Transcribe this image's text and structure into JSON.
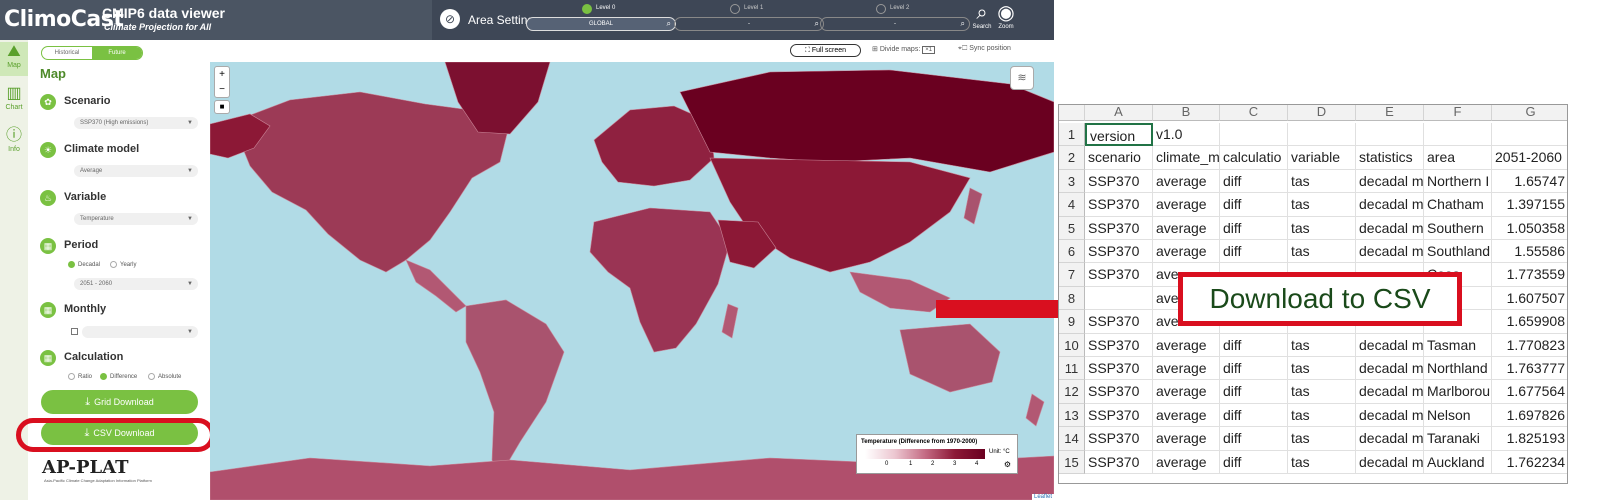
{
  "header": {
    "brand": "ClimoCast",
    "product": "CMIP6 data viewer",
    "tagline": "Climate Projection for All",
    "area_settings": "Area Settings",
    "levels": [
      {
        "label": "Level 0",
        "value": "GLOBAL",
        "active": true
      },
      {
        "label": "Level 1",
        "value": "-",
        "active": false
      },
      {
        "label": "Level 2",
        "value": "-",
        "active": false
      }
    ],
    "search_label": "Search",
    "zoom_label": "Zoom"
  },
  "iconbar": {
    "map": "Map",
    "chart": "Chart",
    "info": "Info"
  },
  "panel": {
    "toggle_historical": "Historical",
    "toggle_future": "Future",
    "title": "Map",
    "scenario_label": "Scenario",
    "scenario_value": "SSP370 (High emissions)",
    "climate_model_label": "Climate model",
    "climate_model_value": "Average",
    "variable_label": "Variable",
    "variable_value": "Temperature",
    "period_label": "Period",
    "period_decadal": "Decadal",
    "period_yearly": "Yearly",
    "period_value": "2051 - 2060",
    "monthly_label": "Monthly",
    "calculation_label": "Calculation",
    "calc_ratio": "Ratio",
    "calc_difference": "Difference",
    "calc_absolute": "Absolute",
    "grid_download": "Grid Download",
    "csv_download": "CSV Download",
    "logo": "AP-PLAT",
    "logo_sub": "Asia-Pacific Climate Change Adaptation Information Platform"
  },
  "map_tools": {
    "full_screen": "Full screen",
    "divide_maps": "Divide maps",
    "divide_value": "×1",
    "sync_position": "Sync position"
  },
  "legend": {
    "title": "Temperature (Difference from 1970-2000)",
    "unit": "Unit: °C",
    "ticks": [
      "0",
      "1",
      "2",
      "3",
      "4"
    ]
  },
  "credit": "Leaflet",
  "callout": "Download to CSV",
  "sheet": {
    "columns": [
      "A",
      "B",
      "C",
      "D",
      "E",
      "F",
      "G"
    ],
    "row_numbers": [
      "1",
      "2",
      "3",
      "4",
      "5",
      "6",
      "7",
      "8",
      "9",
      "10",
      "11",
      "12",
      "13",
      "14",
      "15"
    ],
    "rows": [
      [
        "version",
        "v1.0",
        "",
        "",
        "",
        "",
        ""
      ],
      [
        "scenario",
        "climate_m",
        "calculatio",
        "variable",
        "statistics",
        "area",
        "2051-2060"
      ],
      [
        "SSP370",
        "average",
        "diff",
        "tas",
        "decadal m",
        "Northern I",
        "1.65747"
      ],
      [
        "SSP370",
        "average",
        "diff",
        "tas",
        "decadal m",
        "Chatham",
        "1.397155"
      ],
      [
        "SSP370",
        "average",
        "diff",
        "tas",
        "decadal m",
        "Southern",
        "1.050358"
      ],
      [
        "SSP370",
        "average",
        "diff",
        "tas",
        "decadal m",
        "Southland",
        "1.55586"
      ],
      [
        "SSP370",
        "ave",
        "",
        "",
        "",
        "Coas",
        "1.773559"
      ],
      [
        "",
        "ave",
        "",
        "",
        "",
        "",
        "1.607507"
      ],
      [
        "SSP370",
        "ave",
        "",
        "",
        "",
        "rbur",
        "1.659908"
      ],
      [
        "SSP370",
        "average",
        "diff",
        "tas",
        "decadal m",
        "Tasman",
        "1.770823"
      ],
      [
        "SSP370",
        "average",
        "diff",
        "tas",
        "decadal m",
        "Northland",
        "1.763777"
      ],
      [
        "SSP370",
        "average",
        "diff",
        "tas",
        "decadal m",
        "Marlborou",
        "1.677564"
      ],
      [
        "SSP370",
        "average",
        "diff",
        "tas",
        "decadal m",
        "Nelson",
        "1.697826"
      ],
      [
        "SSP370",
        "average",
        "diff",
        "tas",
        "decadal m",
        "Taranaki",
        "1.825193"
      ],
      [
        "SSP370",
        "average",
        "diff",
        "tas",
        "decadal m",
        "Auckland",
        "1.762234"
      ]
    ]
  },
  "colors": {
    "accent": "#7ac142",
    "header": "#4b5563",
    "highlight": "#d90f1f",
    "map_water": "#b1dbe6",
    "map_land": "#8c1836"
  },
  "icons": [
    "search-icon",
    "eye-icon",
    "map-icon",
    "chart-icon",
    "info-icon",
    "download-icon",
    "gear-icon",
    "layers-icon",
    "fullscreen-icon"
  ]
}
